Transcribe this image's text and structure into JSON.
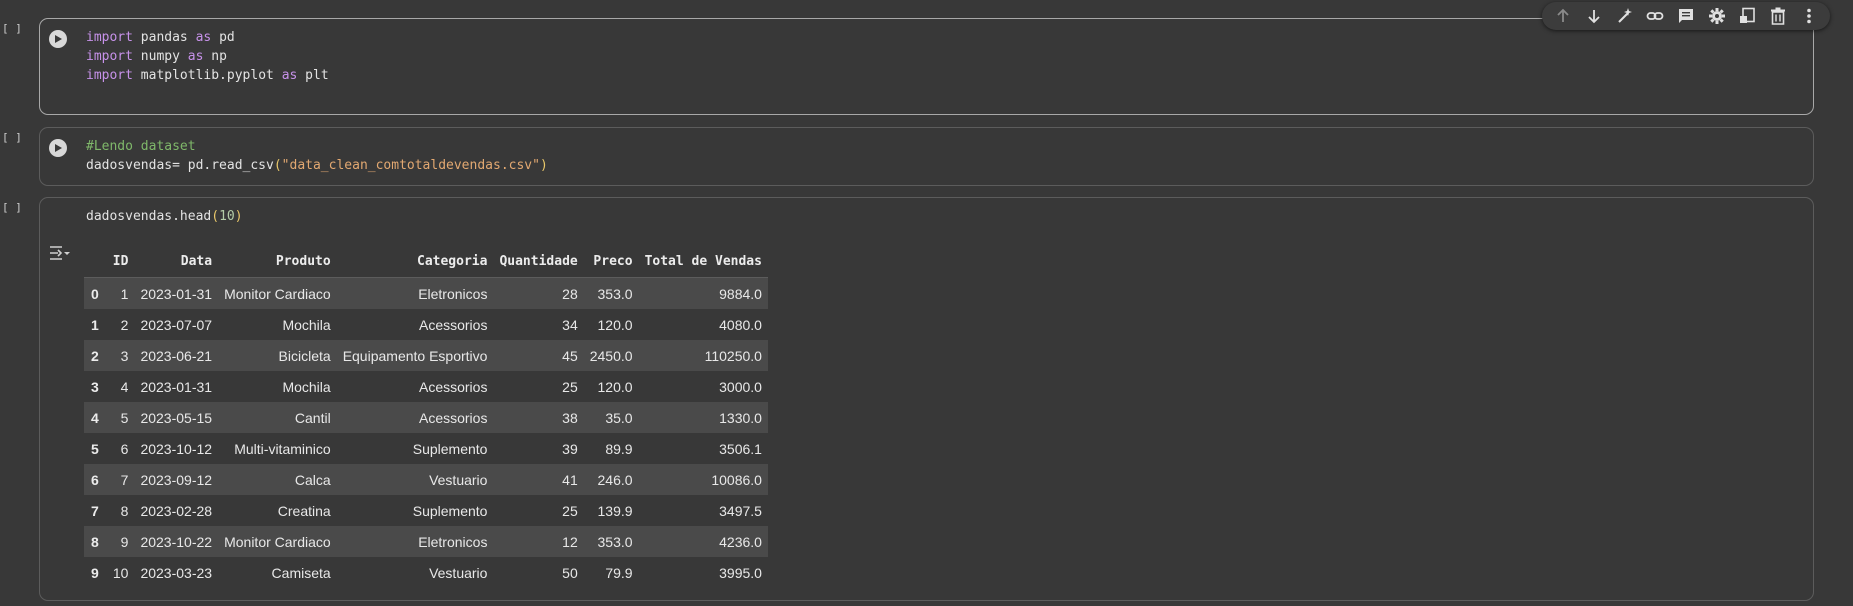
{
  "toolbar": {
    "items": [
      {
        "name": "move-up-icon"
      },
      {
        "name": "move-down-icon"
      },
      {
        "name": "magic-wand-icon"
      },
      {
        "name": "link-icon"
      },
      {
        "name": "comment-icon"
      },
      {
        "name": "gear-icon"
      },
      {
        "name": "mirror-cell-icon"
      },
      {
        "name": "trash-icon"
      },
      {
        "name": "more-vert-icon"
      }
    ]
  },
  "cells": [
    {
      "bracket": "[ ]",
      "code_lines": [
        {
          "kw1": "import",
          "t1": " pandas ",
          "kw2": "as",
          "t2": " pd"
        },
        {
          "kw1": "import",
          "t1": " numpy ",
          "kw2": "as",
          "t2": " np"
        },
        {
          "kw1": "import",
          "t1": " matplotlib.pyplot ",
          "kw2": "as",
          "t2": " plt"
        }
      ]
    },
    {
      "bracket": "[ ]",
      "comment": "#Lendo dataset",
      "assign": "dadosvendas= pd.read_csv",
      "open": "(",
      "string": "\"data_clean_comtotaldevendas.csv\"",
      "close": ")"
    },
    {
      "bracket": "[ ]",
      "call": "dadosvendas.head",
      "open": "(",
      "arg": "10",
      "close": ")"
    }
  ],
  "dataframe": {
    "columns": [
      "",
      "ID",
      "Data",
      "Produto",
      "Categoria",
      "Quantidade",
      "Preco",
      "Total de Vendas"
    ],
    "rows": [
      [
        "0",
        "1",
        "2023-01-31",
        "Monitor Cardiaco",
        "Eletronicos",
        "28",
        "353.0",
        "9884.0"
      ],
      [
        "1",
        "2",
        "2023-07-07",
        "Mochila",
        "Acessorios",
        "34",
        "120.0",
        "4080.0"
      ],
      [
        "2",
        "3",
        "2023-06-21",
        "Bicicleta",
        "Equipamento Esportivo",
        "45",
        "2450.0",
        "110250.0"
      ],
      [
        "3",
        "4",
        "2023-01-31",
        "Mochila",
        "Acessorios",
        "25",
        "120.0",
        "3000.0"
      ],
      [
        "4",
        "5",
        "2023-05-15",
        "Cantil",
        "Acessorios",
        "38",
        "35.0",
        "1330.0"
      ],
      [
        "5",
        "6",
        "2023-10-12",
        "Multi-vitaminico",
        "Suplemento",
        "39",
        "89.9",
        "3506.1"
      ],
      [
        "6",
        "7",
        "2023-09-12",
        "Calca",
        "Vestuario",
        "41",
        "246.0",
        "10086.0"
      ],
      [
        "7",
        "8",
        "2023-02-28",
        "Creatina",
        "Suplemento",
        "25",
        "139.9",
        "3497.5"
      ],
      [
        "8",
        "9",
        "2023-10-22",
        "Monitor Cardiaco",
        "Eletronicos",
        "12",
        "353.0",
        "4236.0"
      ],
      [
        "9",
        "10",
        "2023-03-23",
        "Camiseta",
        "Vestuario",
        "50",
        "79.9",
        "3995.0"
      ]
    ]
  }
}
